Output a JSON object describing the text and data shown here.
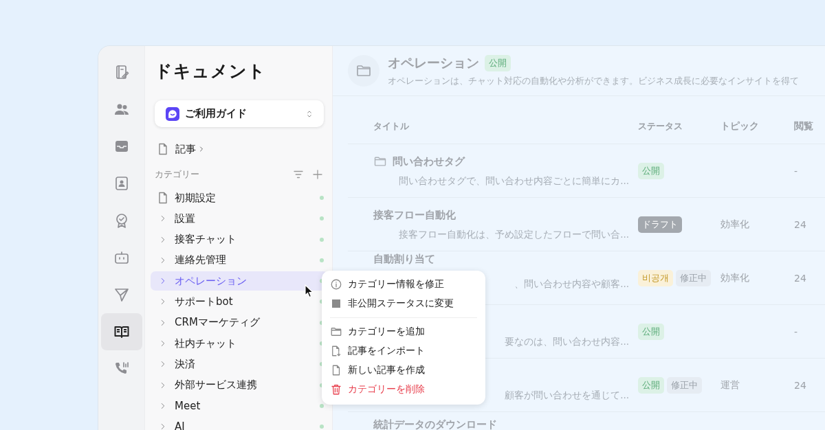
{
  "rail": [
    {
      "kind": "note",
      "selected": false
    },
    {
      "kind": "people",
      "selected": false
    },
    {
      "kind": "inbox",
      "selected": false
    },
    {
      "kind": "contact",
      "selected": false
    },
    {
      "kind": "badge",
      "selected": false
    },
    {
      "kind": "bot",
      "selected": false
    },
    {
      "kind": "send",
      "selected": false
    },
    {
      "kind": "book",
      "selected": true
    },
    {
      "kind": "phone",
      "selected": false
    }
  ],
  "sidebar": {
    "title": "ドキュメント",
    "guide": "ご利用ガイド",
    "articles": "記事",
    "categories_label": "カテゴリー",
    "items": [
      {
        "kind": "page",
        "label": "初期設定",
        "selected": false,
        "published": true
      },
      {
        "kind": "folder",
        "label": "設置",
        "selected": false,
        "published": true
      },
      {
        "kind": "folder",
        "label": "接客チャット",
        "selected": false,
        "published": true
      },
      {
        "kind": "folder",
        "label": "連絡先管理",
        "selected": false,
        "published": true
      },
      {
        "kind": "folder",
        "label": "オペレーション",
        "selected": true,
        "published": true
      },
      {
        "kind": "folder",
        "label": "サポートbot",
        "selected": false,
        "published": true
      },
      {
        "kind": "folder",
        "label": "CRMマーケティグ",
        "selected": false,
        "published": true
      },
      {
        "kind": "folder",
        "label": "社内チャット",
        "selected": false,
        "published": true
      },
      {
        "kind": "folder",
        "label": "決済",
        "selected": false,
        "published": true
      },
      {
        "kind": "folder",
        "label": "外部サービス連携",
        "selected": false,
        "published": true
      },
      {
        "kind": "folder",
        "label": "Meet",
        "selected": false,
        "published": true
      },
      {
        "kind": "folder",
        "label": "AI",
        "selected": false,
        "published": true
      }
    ]
  },
  "header": {
    "title": "オペレーション",
    "badge": "公開",
    "description": "オペレーションは、チャット対応の自動化や分析ができます。ビジネス成長に必要なインサイトを得て"
  },
  "table": {
    "columns": [
      "タイトル",
      "ステータス",
      "トピック",
      "閲覧"
    ],
    "rows": [
      {
        "kind": "folder",
        "title": "問い合わせタグ",
        "description": "問い合わせタグで、問い合わせ内容ごとに簡単にカ...",
        "badges": [
          {
            "kind": "public",
            "label": "公開"
          }
        ],
        "topic": "",
        "views": "-"
      },
      {
        "kind": "article",
        "title": "接客フロー自動化",
        "description": "接客フロー自動化は、予め設定したフローで問い合...",
        "badges": [
          {
            "kind": "draft",
            "label": "ドラフト"
          }
        ],
        "topic": "効率化",
        "views": "24"
      },
      {
        "kind": "article",
        "title": "自動割り当て",
        "description": "、問い合わせ内容や顧客...",
        "badges": [
          {
            "kind": "private",
            "label": "비공개"
          },
          {
            "kind": "editing",
            "label": "修正中"
          }
        ],
        "topic": "効率化",
        "views": "24"
      },
      {
        "kind": "article",
        "title": "",
        "description": "要なのは、問い合わせ内容...",
        "badges": [
          {
            "kind": "public",
            "label": "公開"
          }
        ],
        "topic": "",
        "views": "-"
      },
      {
        "kind": "article",
        "title": "",
        "description": "顧客が問い合わせを通じて...",
        "badges": [
          {
            "kind": "public",
            "label": "公開"
          },
          {
            "kind": "editing",
            "label": "修正中"
          }
        ],
        "topic": "運営",
        "views": "24"
      },
      {
        "kind": "article",
        "title": "統計データのダウンロード",
        "description": "",
        "badges": [],
        "topic": "",
        "views": ""
      }
    ]
  },
  "context_menu": {
    "sections": [
      [
        {
          "kind": "info",
          "label": "カテゴリー情報を修正",
          "danger": false
        },
        {
          "kind": "status",
          "label": "非公開ステータスに変更",
          "danger": false
        }
      ],
      [
        {
          "kind": "add_category",
          "label": "カテゴリーを追加",
          "danger": false
        },
        {
          "kind": "import",
          "label": "記事をインポート",
          "danger": false
        },
        {
          "kind": "new_article",
          "label": "新しい記事を作成",
          "danger": false
        },
        {
          "kind": "delete",
          "label": "カテゴリーを削除",
          "danger": true
        }
      ]
    ]
  }
}
